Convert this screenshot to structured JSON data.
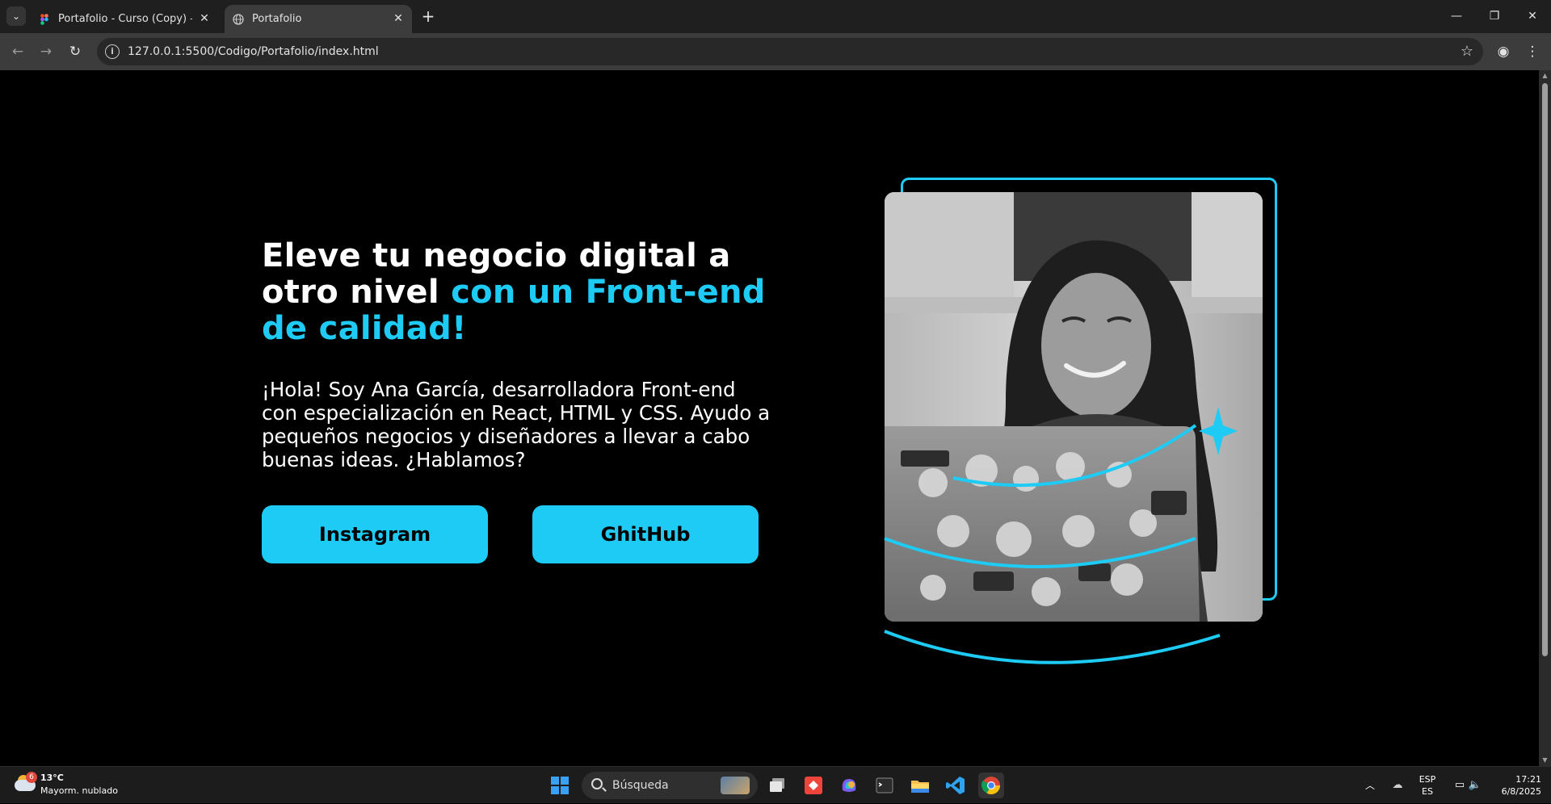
{
  "browser": {
    "tabs": [
      {
        "title": "Portafolio - Curso (Copy) – Figma",
        "active": false,
        "favicon": "figma-icon"
      },
      {
        "title": "Portafolio",
        "active": true,
        "favicon": "globe-icon"
      }
    ],
    "url": "127.0.0.1:5500/Codigo/Portafolio/index.html"
  },
  "hero": {
    "title_white_1": "Eleve tu negocio digital a",
    "title_white_2": "otro nivel ",
    "title_accent": "con un  Front-end  de calidad!",
    "text": "¡Hola! Soy Ana García, desarrolladora Front-end con especialización en React, HTML y CSS. Ayudo a pequeños negocios y diseñadores a llevar a cabo buenas ideas. ¿Hablamos?",
    "buttons": {
      "instagram": "Instagram",
      "github": "GhitHub"
    },
    "accent_color": "#1ecbf5"
  },
  "taskbar": {
    "weather": {
      "temp": "13°C",
      "condition": "Mayorm. nublado",
      "badge": "6"
    },
    "search_placeholder": "Búsqueda",
    "language": {
      "line1": "ESP",
      "line2": "ES"
    },
    "clock": {
      "time": "17:21",
      "date": "6/8/2025"
    }
  }
}
